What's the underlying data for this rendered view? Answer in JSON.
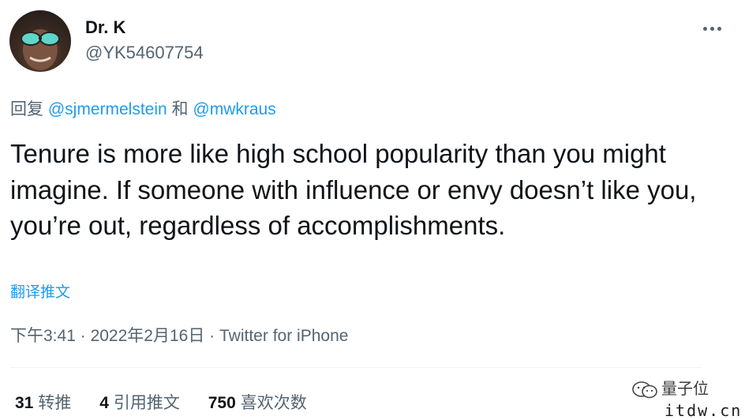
{
  "author": {
    "name": "Dr. K",
    "handle": "@YK54607754"
  },
  "reply": {
    "prefix": "回复",
    "mention1": "@sjmermelstein",
    "conj": "和",
    "mention2": "@mwkraus"
  },
  "tweet": {
    "text": "Tenure is more like high school popularity than you might imagine. If someone with influence or envy doesn’t like you, you’re out, regardless of accomplishments.",
    "translate_label": "翻译推文",
    "time": "下午3:41",
    "sep": "·",
    "date": "2022年2月16日",
    "source": "Twitter for iPhone"
  },
  "stats": {
    "retweets": {
      "count": "31",
      "label": "转推"
    },
    "quotes": {
      "count": "4",
      "label": "引用推文"
    },
    "likes": {
      "count": "750",
      "label": "喜欢次数"
    }
  },
  "watermark": {
    "brand": "量子位",
    "site": "itdw.cn"
  },
  "colors": {
    "link": "#1d9bf0",
    "secondary": "#536471",
    "text": "#0f1419",
    "divider": "#eff3f4"
  },
  "icons": {
    "more": "more-dots-icon",
    "watermark": "wechat-icon"
  }
}
